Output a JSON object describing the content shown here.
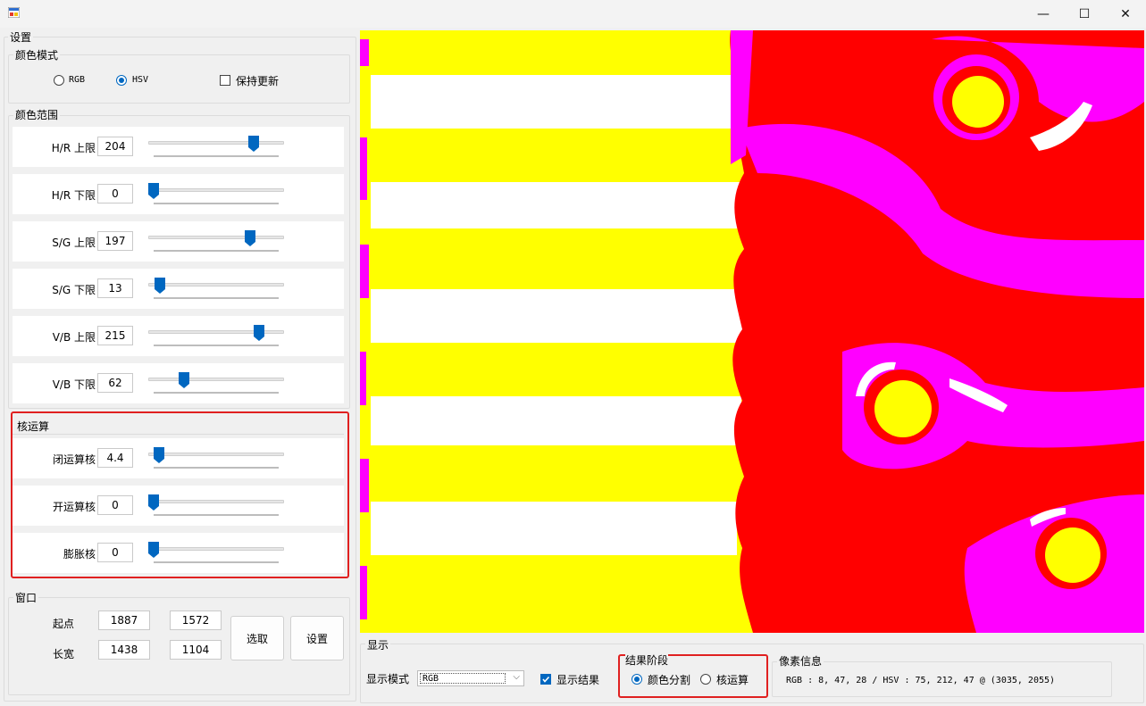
{
  "window": {
    "minimize": "—",
    "maximize": "☐",
    "close": "✕"
  },
  "settings": {
    "title": "设置",
    "color_mode": {
      "title": "颜色模式",
      "options": [
        "RGB",
        "HSV"
      ],
      "selected": "HSV",
      "keep_update_label": "保持更新",
      "keep_update_checked": false
    },
    "color_range": {
      "title": "颜色范围",
      "rows": [
        {
          "label": "H/R 上限",
          "value": "204",
          "fraction": 0.8
        },
        {
          "label": "H/R 下限",
          "value": "0",
          "fraction": 0.0
        },
        {
          "label": "S/G 上限",
          "value": "197",
          "fraction": 0.77
        },
        {
          "label": "S/G 下限",
          "value": "13",
          "fraction": 0.05
        },
        {
          "label": "V/B 上限",
          "value": "215",
          "fraction": 0.84
        },
        {
          "label": "V/B 下限",
          "value": "62",
          "fraction": 0.24
        }
      ]
    },
    "kernel": {
      "title": "核运算",
      "rows": [
        {
          "label": "闭运算核",
          "value": "4.4",
          "fraction": 0.04
        },
        {
          "label": "开运算核",
          "value": "0",
          "fraction": 0.0
        },
        {
          "label": "膨胀核",
          "value": "0",
          "fraction": 0.0
        }
      ]
    },
    "window": {
      "title": "窗口",
      "start_label": "起点",
      "size_label": "长宽",
      "start_x": "1887",
      "start_y": "1572",
      "width": "1438",
      "height": "1104",
      "select_button": "选取",
      "set_button": "设置"
    }
  },
  "display": {
    "title": "显示",
    "mode_label": "显示模式",
    "mode_value": "RGB",
    "show_result_label": "显示结果",
    "show_result_checked": true,
    "result_stage": {
      "title": "结果阶段",
      "options": [
        "颜色分割",
        "核运算"
      ],
      "selected": "颜色分割"
    },
    "pixel_info": {
      "title": "像素信息",
      "text": "RGB : 8, 47, 28 / HSV : 75, 212, 47 @ (3035, 2055)"
    }
  },
  "colors": {
    "accent": "#0067c0",
    "highlight": "#e02020",
    "seg_red": "#ff0000",
    "seg_yellow": "#ffff00",
    "seg_magenta": "#ff00ff",
    "seg_white": "#ffffff"
  }
}
